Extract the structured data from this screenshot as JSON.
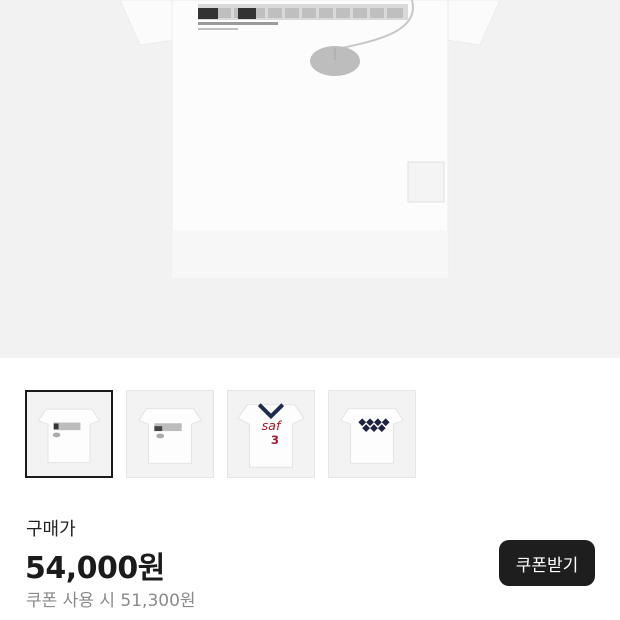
{
  "product": {
    "hero_alt": "product-main-image",
    "price_label": "구매가",
    "price": "54,000원",
    "coupon_price": "쿠폰 사용 시 51,300원",
    "coupon_button": "쿠폰받기"
  },
  "thumbnails": [
    {
      "selected": true
    },
    {
      "selected": false
    },
    {
      "selected": false
    },
    {
      "selected": false
    }
  ],
  "colors": {
    "button_bg": "#1e1e1e",
    "price_text": "#1b1b1b",
    "muted_text": "#8a8a8a",
    "hero_bg": "#f2f2f2"
  }
}
